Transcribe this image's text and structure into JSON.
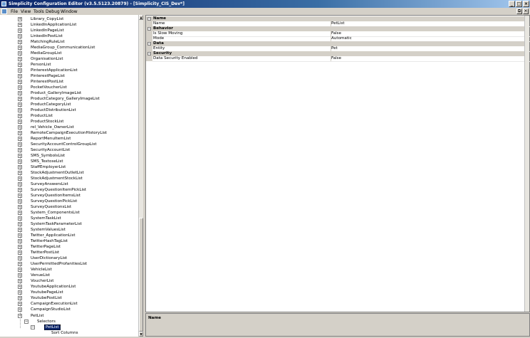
{
  "window": {
    "title": "Simplicity Configuration Editor (v3.5.5123.20879) - [Simplicity_CIS_Dev*]",
    "minimize": "_",
    "maximize": "□",
    "close": "×"
  },
  "menu": {
    "items": [
      "File",
      "View",
      "Tools",
      "Debug",
      "Window"
    ]
  },
  "mdi": {
    "restore": "⧉",
    "close": "×"
  },
  "tree": {
    "items": [
      "Library_CopyList",
      "LinkedInApplicationList",
      "LinkedInPageList",
      "LinkedInPostList",
      "MatchingRuleList",
      "MediaGroup_CommunicationList",
      "MediaGroupList",
      "OrganisationList",
      "PersonList",
      "PinterestApplicationList",
      "PinterestPageList",
      "PinterestPostList",
      "PocketVoucherList",
      "Product_GalleryImageList",
      "ProductCategory_GalleryImageList",
      "ProductCategoryList",
      "ProductDistributionList",
      "ProductList",
      "ProductStockList",
      "rel_Vehicle_OwnerList",
      "RemoteCampaignExecutionHistoryList",
      "ReportMenuItemList",
      "SecurityAccountControlGroupList",
      "SecurityAccountList",
      "SMS_SymbolsList",
      "SMS_TextoseList",
      "StaffEmployerList",
      "StockAdjustmentOutletList",
      "StockAdjustmentStockList",
      "SurveyAnswersList",
      "SurveyQuestionItemPickList",
      "SurveyQuestionItemsList",
      "SurveyQuestionPickList",
      "SurveyQuestionsList",
      "System_ComponentsList",
      "SystemTaskList",
      "SystemTaskParameterList",
      "SystemValuesList",
      "Twitter_ApplicationList",
      "TwitterHashTagList",
      "TwitterPageList",
      "TwitterPostList",
      "UserDictionaryList",
      "UserPermittedProfanitiesList",
      "VehicleList",
      "VenueList",
      "VoucherList",
      "YoutubeApplicationList",
      "YoutubePageList",
      "YoutubePostList",
      "CampaignExecutionList",
      "CampaignStudioList"
    ],
    "pet_list": "PetList",
    "selectors": "Selectors",
    "selected": "PetList",
    "sort_columns": "Sort Columns"
  },
  "properties": {
    "categories": [
      {
        "name": "Name",
        "rows": [
          {
            "name": "Name",
            "value": "PetList"
          }
        ]
      },
      {
        "name": "Behavior",
        "rows": [
          {
            "name": "Is Slow Moving",
            "value": "False"
          },
          {
            "name": "Mode",
            "value": "Automatic"
          }
        ]
      },
      {
        "name": "Data",
        "rows": [
          {
            "name": "Entity",
            "value": "Pet"
          }
        ]
      },
      {
        "name": "Security",
        "rows": [
          {
            "name": "Data Security Enabled",
            "value": "False"
          }
        ]
      }
    ]
  },
  "description": {
    "title": "Name"
  }
}
